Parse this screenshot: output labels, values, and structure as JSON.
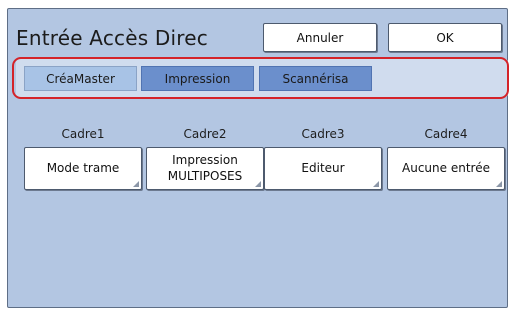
{
  "dialog": {
    "title": "Entrée Accès Direc",
    "cancel_label": "Annuler",
    "ok_label": "OK"
  },
  "tabs": [
    {
      "label": "CréaMaster",
      "selected": true
    },
    {
      "label": "Impression",
      "selected": false
    },
    {
      "label": "Scannérisa",
      "selected": false
    }
  ],
  "frames": [
    {
      "label": "Cadre1",
      "value": "Mode trame"
    },
    {
      "label": "Cadre2",
      "value": "Impression\nMULTIPOSES"
    },
    {
      "label": "Cadre3",
      "value": "Editeur"
    },
    {
      "label": "Cadre4",
      "value": "Aucune entrée"
    }
  ],
  "colors": {
    "panel_background": "#b3c6e2",
    "tab_selected": "#a8c3e6",
    "tab_unselected": "#6b8fcc",
    "highlight_outline": "#d42329"
  }
}
